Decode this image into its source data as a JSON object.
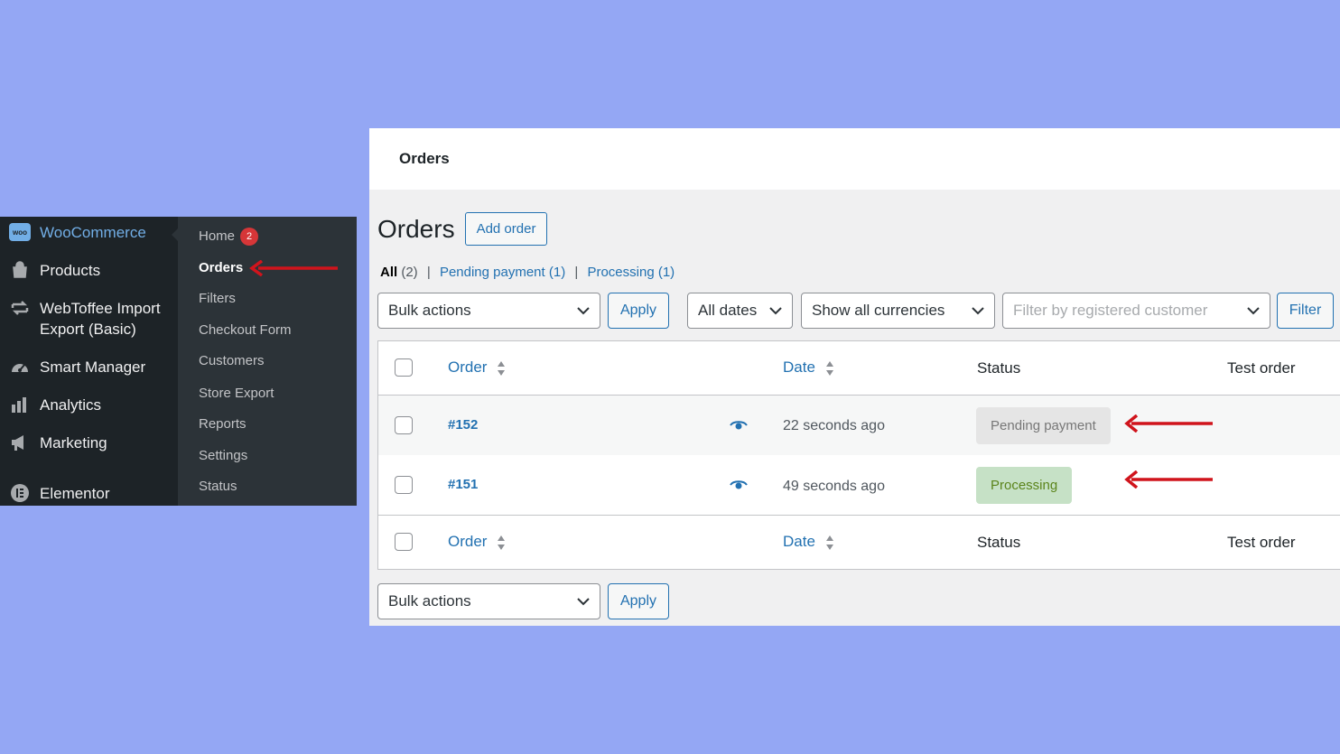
{
  "sidebar": {
    "main_items": [
      {
        "label": "WooCommerce",
        "icon": "woo-icon",
        "active": true
      },
      {
        "label": "Products",
        "icon": "archive-icon"
      },
      {
        "label": "WebToffee Import\nExport (Basic)",
        "icon": "import-export-icon"
      },
      {
        "label": "Smart Manager",
        "icon": "dashboard-gauge-icon"
      },
      {
        "label": "Analytics",
        "icon": "bar-chart-icon"
      },
      {
        "label": "Marketing",
        "icon": "megaphone-icon"
      },
      {
        "label": "Elementor",
        "icon": "elementor-icon"
      }
    ],
    "woo_badge": "woo",
    "sub_items": [
      {
        "label": "Home",
        "badge": "2"
      },
      {
        "label": "Orders",
        "current": true
      },
      {
        "label": "Filters"
      },
      {
        "label": "Checkout Form"
      },
      {
        "label": "Customers"
      },
      {
        "label": "Store Export"
      },
      {
        "label": "Reports"
      },
      {
        "label": "Settings"
      },
      {
        "label": "Status"
      }
    ]
  },
  "panel": {
    "topbar_title": "Orders",
    "page_title": "Orders",
    "add_order_label": "Add order",
    "views": [
      {
        "label": "All",
        "count": "(2)"
      },
      {
        "label": "Pending payment",
        "count": "(1)"
      },
      {
        "label": "Processing",
        "count": "(1)"
      }
    ],
    "view_separator": "|",
    "filters": {
      "bulk_actions": "Bulk actions",
      "apply": "Apply",
      "dates": "All dates",
      "currencies": "Show all currencies",
      "customer_placeholder": "Filter by registered customer",
      "filter_button": "Filter"
    },
    "table": {
      "columns": {
        "order": "Order",
        "date": "Date",
        "status": "Status",
        "test_order": "Test order"
      },
      "rows": [
        {
          "order": "#152",
          "date": "22 seconds ago",
          "status": "Pending payment"
        },
        {
          "order": "#151",
          "date": "49 seconds ago",
          "status": "Processing"
        }
      ]
    },
    "bottom": {
      "bulk_actions": "Bulk actions",
      "apply": "Apply"
    }
  },
  "colors": {
    "background": "#94a7f4",
    "link": "#2271b1",
    "arrow": "#d0141c",
    "badge": "#d63638",
    "pending_bg": "#e5e5e5",
    "processing_bg": "#c6e1c6"
  }
}
